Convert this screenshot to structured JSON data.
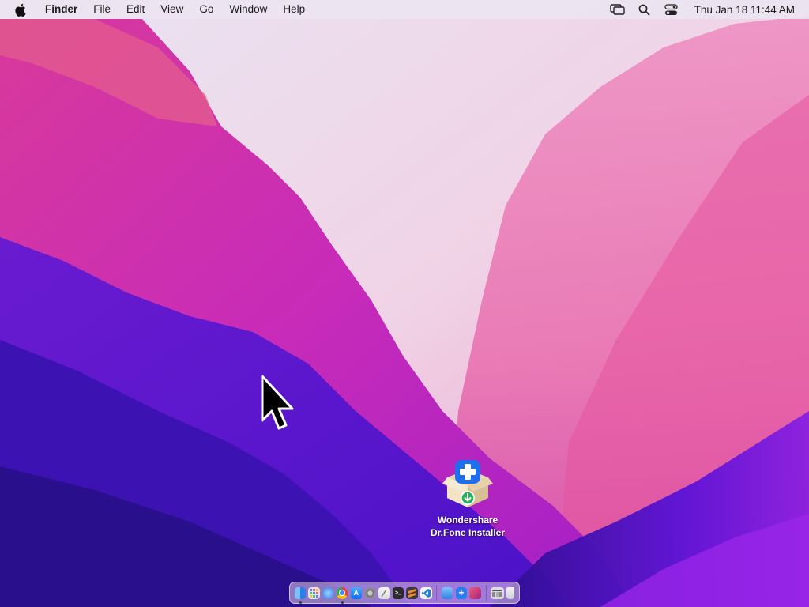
{
  "menubar": {
    "app_name": "Finder",
    "menus": [
      "File",
      "Edit",
      "View",
      "Go",
      "Window",
      "Help"
    ],
    "clock": "Thu Jan 18  11:44 AM",
    "status_icons": [
      "screen-mirroring-icon",
      "spotlight-search-icon",
      "control-center-icon"
    ]
  },
  "desktop_icon": {
    "line1": "Wondershare",
    "line2": "Dr.Fone Installer",
    "icon": "installer-box-icon"
  },
  "dock": {
    "apps": [
      {
        "name": "finder",
        "color": "#3b8ff0",
        "running": true
      },
      {
        "name": "launchpad",
        "color": "#d9dde6",
        "running": false
      },
      {
        "name": "safari",
        "color": "#3a86e6",
        "running": false
      },
      {
        "name": "chrome",
        "color": "#f2f2f2",
        "running": true
      },
      {
        "name": "app-store",
        "color": "#1f8ff5",
        "running": false
      },
      {
        "name": "system-settings",
        "color": "#8e8e93",
        "running": false
      },
      {
        "name": "notes",
        "color": "#f2f2f2",
        "running": false
      },
      {
        "name": "terminal",
        "color": "#2b2b2b",
        "running": false
      },
      {
        "name": "sublime",
        "color": "#f08a24",
        "running": false
      },
      {
        "name": "vscode",
        "color": "#1f7fd8",
        "running": false
      }
    ],
    "recent": [
      {
        "name": "preview",
        "color": "#3d8fe0",
        "running": false
      },
      {
        "name": "dr-fone",
        "color": "#2b7cf0",
        "running": false
      },
      {
        "name": "photo-app",
        "color": "#d6336c",
        "running": false
      }
    ],
    "trailing": [
      {
        "name": "downloads-folder",
        "color": "#d8d8dc"
      },
      {
        "name": "trash",
        "color": "#e8e8ec"
      }
    ]
  }
}
